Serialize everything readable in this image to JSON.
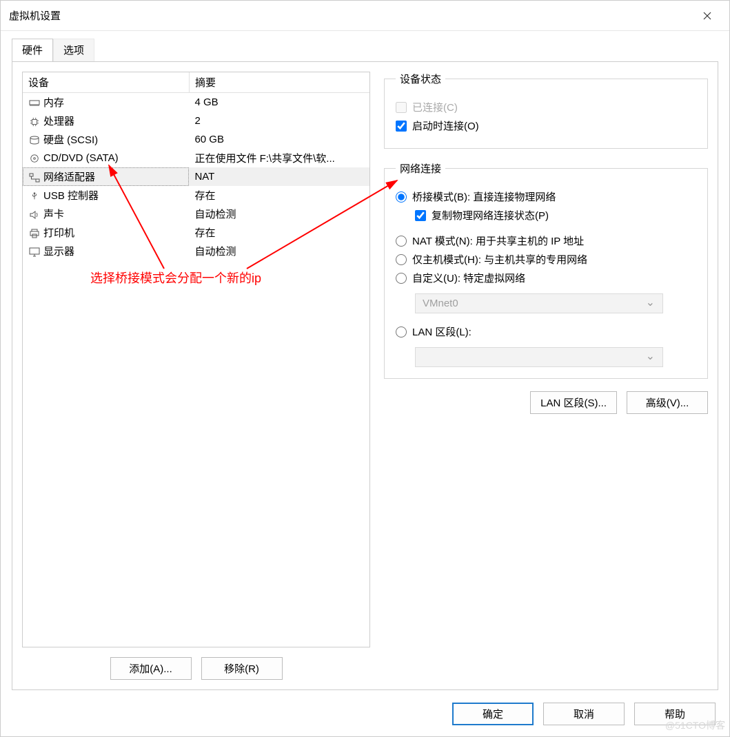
{
  "window": {
    "title": "虚拟机设置"
  },
  "tabs": {
    "hardware": "硬件",
    "options": "选项"
  },
  "device_table": {
    "col_device": "设备",
    "col_summary": "摘要",
    "rows": [
      {
        "icon": "memory-icon",
        "name": "内存",
        "summary": "4 GB"
      },
      {
        "icon": "cpu-icon",
        "name": "处理器",
        "summary": "2"
      },
      {
        "icon": "disk-icon",
        "name": "硬盘 (SCSI)",
        "summary": "60 GB"
      },
      {
        "icon": "cd-icon",
        "name": "CD/DVD (SATA)",
        "summary": "正在使用文件 F:\\共享文件\\软..."
      },
      {
        "icon": "network-icon",
        "name": "网络适配器",
        "summary": "NAT",
        "selected": true
      },
      {
        "icon": "usb-icon",
        "name": "USB 控制器",
        "summary": "存在"
      },
      {
        "icon": "sound-icon",
        "name": "声卡",
        "summary": "自动检测"
      },
      {
        "icon": "printer-icon",
        "name": "打印机",
        "summary": "存在"
      },
      {
        "icon": "display-icon",
        "name": "显示器",
        "summary": "自动检测"
      }
    ]
  },
  "left_buttons": {
    "add": "添加(A)...",
    "remove": "移除(R)"
  },
  "device_state": {
    "legend": "设备状态",
    "connected": "已连接(C)",
    "connect_at_power_on": "启动时连接(O)"
  },
  "net": {
    "legend": "网络连接",
    "bridged": "桥接模式(B): 直接连接物理网络",
    "replicate": "复制物理网络连接状态(P)",
    "nat": "NAT 模式(N): 用于共享主机的 IP 地址",
    "hostonly": "仅主机模式(H): 与主机共享的专用网络",
    "custom": "自定义(U): 特定虚拟网络",
    "custom_value": "VMnet0",
    "lan": "LAN 区段(L):",
    "lan_value": ""
  },
  "right_buttons": {
    "lan_segments": "LAN 区段(S)...",
    "advanced": "高级(V)..."
  },
  "footer": {
    "ok": "确定",
    "cancel": "取消",
    "help": "帮助"
  },
  "annotation": {
    "text": "选择桥接模式会分配一个新的ip"
  },
  "watermark": "@51CTO博客"
}
